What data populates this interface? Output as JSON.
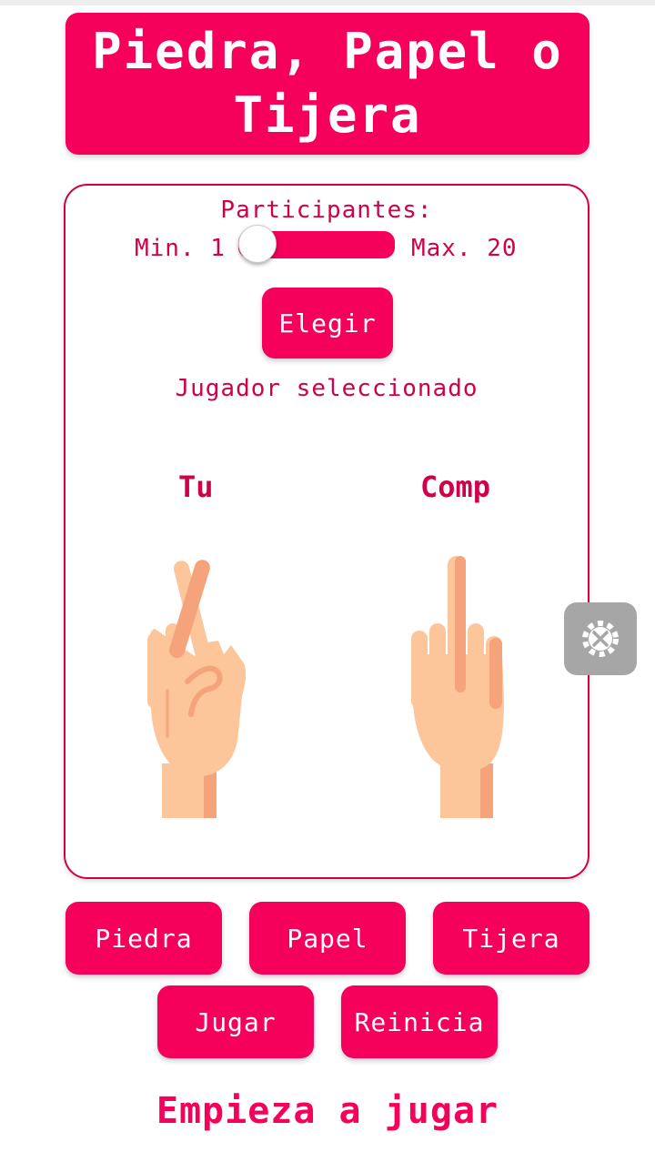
{
  "app": {
    "title": "Piedra, Papel o Tijera"
  },
  "participants": {
    "label": "Participantes:",
    "min_label": "Min. 1",
    "max_label": "Max. 20",
    "value": 1,
    "min": 1,
    "max": 20
  },
  "choose_button": "Elegir",
  "selected_player_text": "Jugador seleccionado",
  "players": {
    "you_label": "Tu",
    "computer_label": "Comp"
  },
  "hands": {
    "you_icon": "crossed-fingers-hand-icon",
    "computer_icon": "middle-finger-hand-icon"
  },
  "moves": {
    "rock": "Piedra",
    "paper": "Papel",
    "scissors": "Tijera"
  },
  "actions": {
    "play": "Jugar",
    "reset": "Reinicia"
  },
  "status": "Empieza a jugar",
  "overlay": {
    "icon": "settings-tools-icon"
  },
  "colors": {
    "accent": "#f5005a",
    "text_accent": "#d0004a",
    "skin": "#fdc59a",
    "skin_shadow": "#f5a37a"
  }
}
